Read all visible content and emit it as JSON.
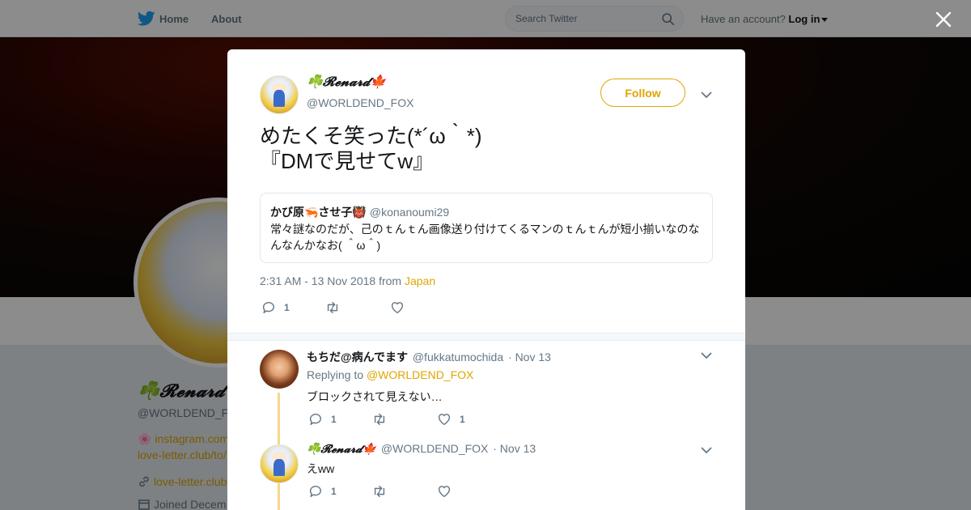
{
  "nav": {
    "home": "Home",
    "about": "About",
    "search_placeholder": "Search Twitter",
    "have_account": "Have an account?",
    "login": "Log in"
  },
  "background_profile": {
    "name": "☘️𝓡𝓮𝓷𝓪𝓻𝓭🍁",
    "handle": "@WORLDEND_F",
    "bio_line1": "🌸 instagram.com",
    "bio_line2": "love-letter.club/to/",
    "link": "love-letter.club",
    "joined": "Joined Decem"
  },
  "tweet": {
    "display_name": "☘️𝓡𝓮𝓷𝓪𝓻𝓭🍁",
    "username": "@WORLDEND_FOX",
    "follow_label": "Follow",
    "text": "めたくそ笑った(*´ω｀*)\n『DMで見せてw』",
    "quote": {
      "name": "かび原🦐させ子👹",
      "handle": "@konanoumi29",
      "text": "常々謎なのだが、己のｔんｔん画像送り付けてくるマンのｔんｔんが短小揃いなのなんなんかなお( ＾ω＾)"
    },
    "time": "2:31 AM - 13 Nov 2018",
    "from_label": "from",
    "location": "Japan",
    "reply_count": "1",
    "retweet_count": "",
    "like_count": ""
  },
  "replies": [
    {
      "name": "もちだ@病んでます",
      "handle": "@fukkatumochida",
      "date": "· Nov 13",
      "replying_label": "Replying to",
      "replying_to": "@WORLDEND_FOX",
      "text": "ブロックされて見えない…",
      "reply_count": "1",
      "like_count": "1"
    },
    {
      "name": "☘️𝓡𝓮𝓷𝓪𝓻𝓭🍁",
      "handle": "@WORLDEND_FOX",
      "date": "· Nov 13",
      "text": "えww",
      "reply_count": "1",
      "like_count": ""
    }
  ],
  "colors": {
    "accent": "#e0a500",
    "text": "#14171a",
    "muted": "#657786",
    "twitter_blue": "#1da1f2"
  }
}
